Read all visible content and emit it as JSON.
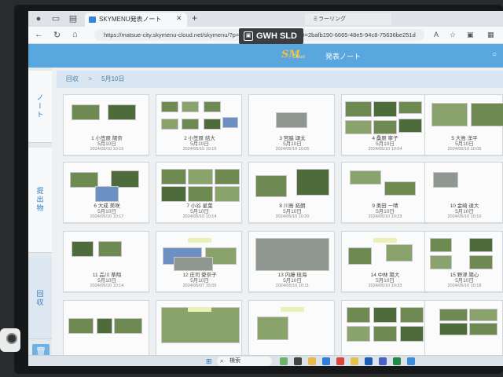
{
  "browser": {
    "tab_title": "SKYMENU発表ノート",
    "tab2_title": "ミラーリング",
    "url": "https://matsue-city.skymenu-cloud.net/skymenu/?p=presenote/list?loginGUID=2bafb190-6665-48e5-94c8-75636be251d"
  },
  "overlay_badge": "GWH SLD",
  "app": {
    "logo_text": "SM",
    "logo_sub": "Cloud",
    "title": "発表ノート"
  },
  "sidebar": {
    "items": [
      {
        "label": "ノート"
      },
      {
        "label": "提出物"
      },
      {
        "label": "回収"
      }
    ]
  },
  "breadcrumb": {
    "root": "回収",
    "separator": ">",
    "current": "5月10日"
  },
  "cards": [
    {
      "title": "1 小笠原 陽奈",
      "date": "5月10日",
      "ts": "2024/05/10 10:15"
    },
    {
      "title": "2 小笠原 結大",
      "date": "5月10日",
      "ts": "2024/05/10 10:16"
    },
    {
      "title": "3 宮脇 頌太",
      "date": "5月10日",
      "ts": "2024/05/10 10:05"
    },
    {
      "title": "4 桑原 寧子",
      "date": "5月10日",
      "ts": "2024/05/10 10:04"
    },
    {
      "title": "5 大島 洋平",
      "date": "5月10日",
      "ts": "2024/05/10 10:05"
    },
    {
      "title": "6 大成 美咲",
      "date": "5月10日",
      "ts": "2024/05/10 10:17"
    },
    {
      "title": "7 小谷 星葉",
      "date": "5月10日",
      "ts": "2024/05/10 10:14"
    },
    {
      "title": "8 川島 拓朗",
      "date": "5月10日",
      "ts": "2024/05/10 10:20"
    },
    {
      "title": "9 奥田 一晴",
      "date": "5月10日",
      "ts": "2024/05/10 10:23"
    },
    {
      "title": "10 金崎 達大",
      "date": "5月10日",
      "ts": "2024/05/10 10:10"
    },
    {
      "title": "11 品川 準翔",
      "date": "5月10日",
      "ts": "2024/05/10 10:14"
    },
    {
      "title": "12 庄司 愛奈子",
      "date": "5月10日",
      "ts": "2024/05/07 15:05"
    },
    {
      "title": "13 内藤 琉海",
      "date": "5月10日",
      "ts": "2024/05/10 10:11"
    },
    {
      "title": "14 中林 陽大",
      "date": "5月10日",
      "ts": "2024/05/10 10:33"
    },
    {
      "title": "15 野津 陽心",
      "date": "5月10日",
      "ts": "2024/05/10 10:18"
    },
    {
      "title": "",
      "date": "",
      "ts": ""
    },
    {
      "title": "",
      "date": "",
      "ts": ""
    },
    {
      "title": "",
      "date": "",
      "ts": ""
    },
    {
      "title": "",
      "date": "",
      "ts": ""
    },
    {
      "title": "",
      "date": "",
      "ts": ""
    }
  ],
  "taskbar": {
    "search_label": "検索"
  }
}
